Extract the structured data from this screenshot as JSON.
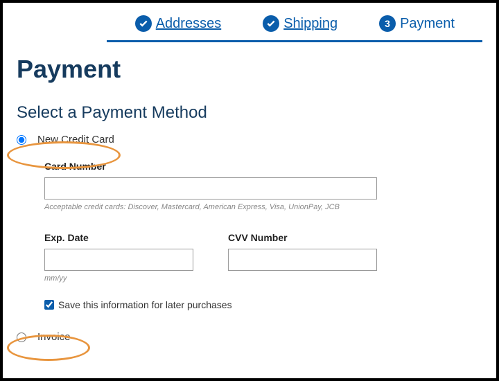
{
  "stepper": {
    "addresses": "Addresses",
    "shipping": "Shipping",
    "payment": "Payment",
    "current_step_number": "3"
  },
  "page": {
    "title": "Payment",
    "subtitle": "Select a Payment Method"
  },
  "options": {
    "new_card": "New Credit Card",
    "invoice": "Invoice"
  },
  "card": {
    "number_label": "Card Number",
    "number_value": "",
    "acceptable": "Acceptable credit cards: Discover, Mastercard, American Express, Visa, UnionPay, JCB",
    "exp_label": "Exp. Date",
    "exp_value": "",
    "exp_hint": "mm/yy",
    "cvv_label": "CVV Number",
    "cvv_value": ""
  },
  "save": {
    "label": "Save this information for later purchases",
    "checked": true
  }
}
